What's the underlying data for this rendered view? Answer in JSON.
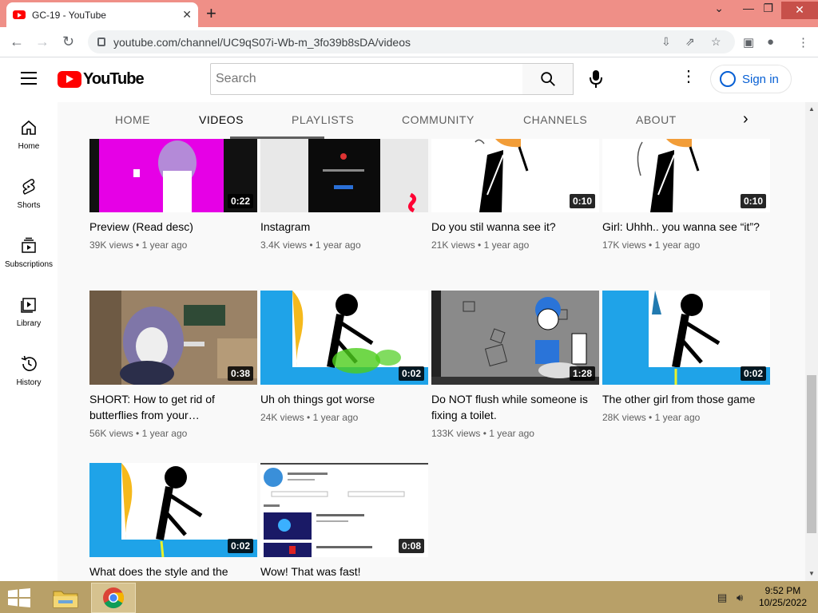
{
  "browser": {
    "tab_title": "GC-19 - YouTube",
    "new_tab": "+",
    "url": "youtube.com/channel/UC9qS07i-Wb-m_3fo39b8sDA/videos"
  },
  "masthead": {
    "logo_text": "YouTube",
    "search_placeholder": "Search",
    "sign_in": "Sign in"
  },
  "sidebar": {
    "items": [
      {
        "label": "Home"
      },
      {
        "label": "Shorts"
      },
      {
        "label": "Subscriptions"
      },
      {
        "label": "Library"
      },
      {
        "label": "History"
      }
    ]
  },
  "channel_tabs": [
    {
      "label": "HOME"
    },
    {
      "label": "VIDEOS"
    },
    {
      "label": "PLAYLISTS"
    },
    {
      "label": "COMMUNITY"
    },
    {
      "label": "CHANNELS"
    },
    {
      "label": "ABOUT"
    }
  ],
  "videos": [
    {
      "title": "Preview (Read desc)",
      "views": "39K views",
      "age": "1 year ago",
      "duration": "0:22",
      "thumb_color": "#e600e6"
    },
    {
      "title": "Instagram",
      "views": "3.4K views",
      "age": "1 year ago",
      "duration": "",
      "thumb_color": "#e8e8e8"
    },
    {
      "title": "Do you stil wanna see it?",
      "views": "21K views",
      "age": "1 year ago",
      "duration": "0:10",
      "thumb_color": "#ffffff"
    },
    {
      "title": "Girl: Uhhh.. you wanna see “it”?",
      "views": "17K views",
      "age": "1 year ago",
      "duration": "0:10",
      "thumb_color": "#ffffff"
    },
    {
      "title": "SHORT: How to get rid of butterflies from your…",
      "views": "56K views",
      "age": "1 year ago",
      "duration": "0:38",
      "thumb_color": "#8b7355"
    },
    {
      "title": "Uh oh things got worse",
      "views": "24K views",
      "age": "1 year ago",
      "duration": "0:02",
      "thumb_color": "#1fa3e8"
    },
    {
      "title": "Do NOT flush while someone is fixing a toilet.",
      "views": "133K views",
      "age": "1 year ago",
      "duration": "1:28",
      "thumb_color": "#8a8a8a"
    },
    {
      "title": "The other girl from those game",
      "views": "28K views",
      "age": "1 year ago",
      "duration": "0:02",
      "thumb_color": "#1fa3e8"
    },
    {
      "title": "What does the style and the",
      "views": "",
      "age": "",
      "duration": "0:02",
      "thumb_color": "#1fa3e8"
    },
    {
      "title": "Wow! That was fast!",
      "views": "",
      "age": "",
      "duration": "0:08",
      "thumb_color": "#ffffff"
    }
  ],
  "meta_separator": "•",
  "taskbar": {
    "time": "9:52 PM",
    "date": "10/25/2022"
  },
  "colors": {
    "tabbar": "#ef8f87",
    "taskbar": "#b8a068",
    "youtube_red": "#ff0000",
    "link_blue": "#065fd4"
  }
}
